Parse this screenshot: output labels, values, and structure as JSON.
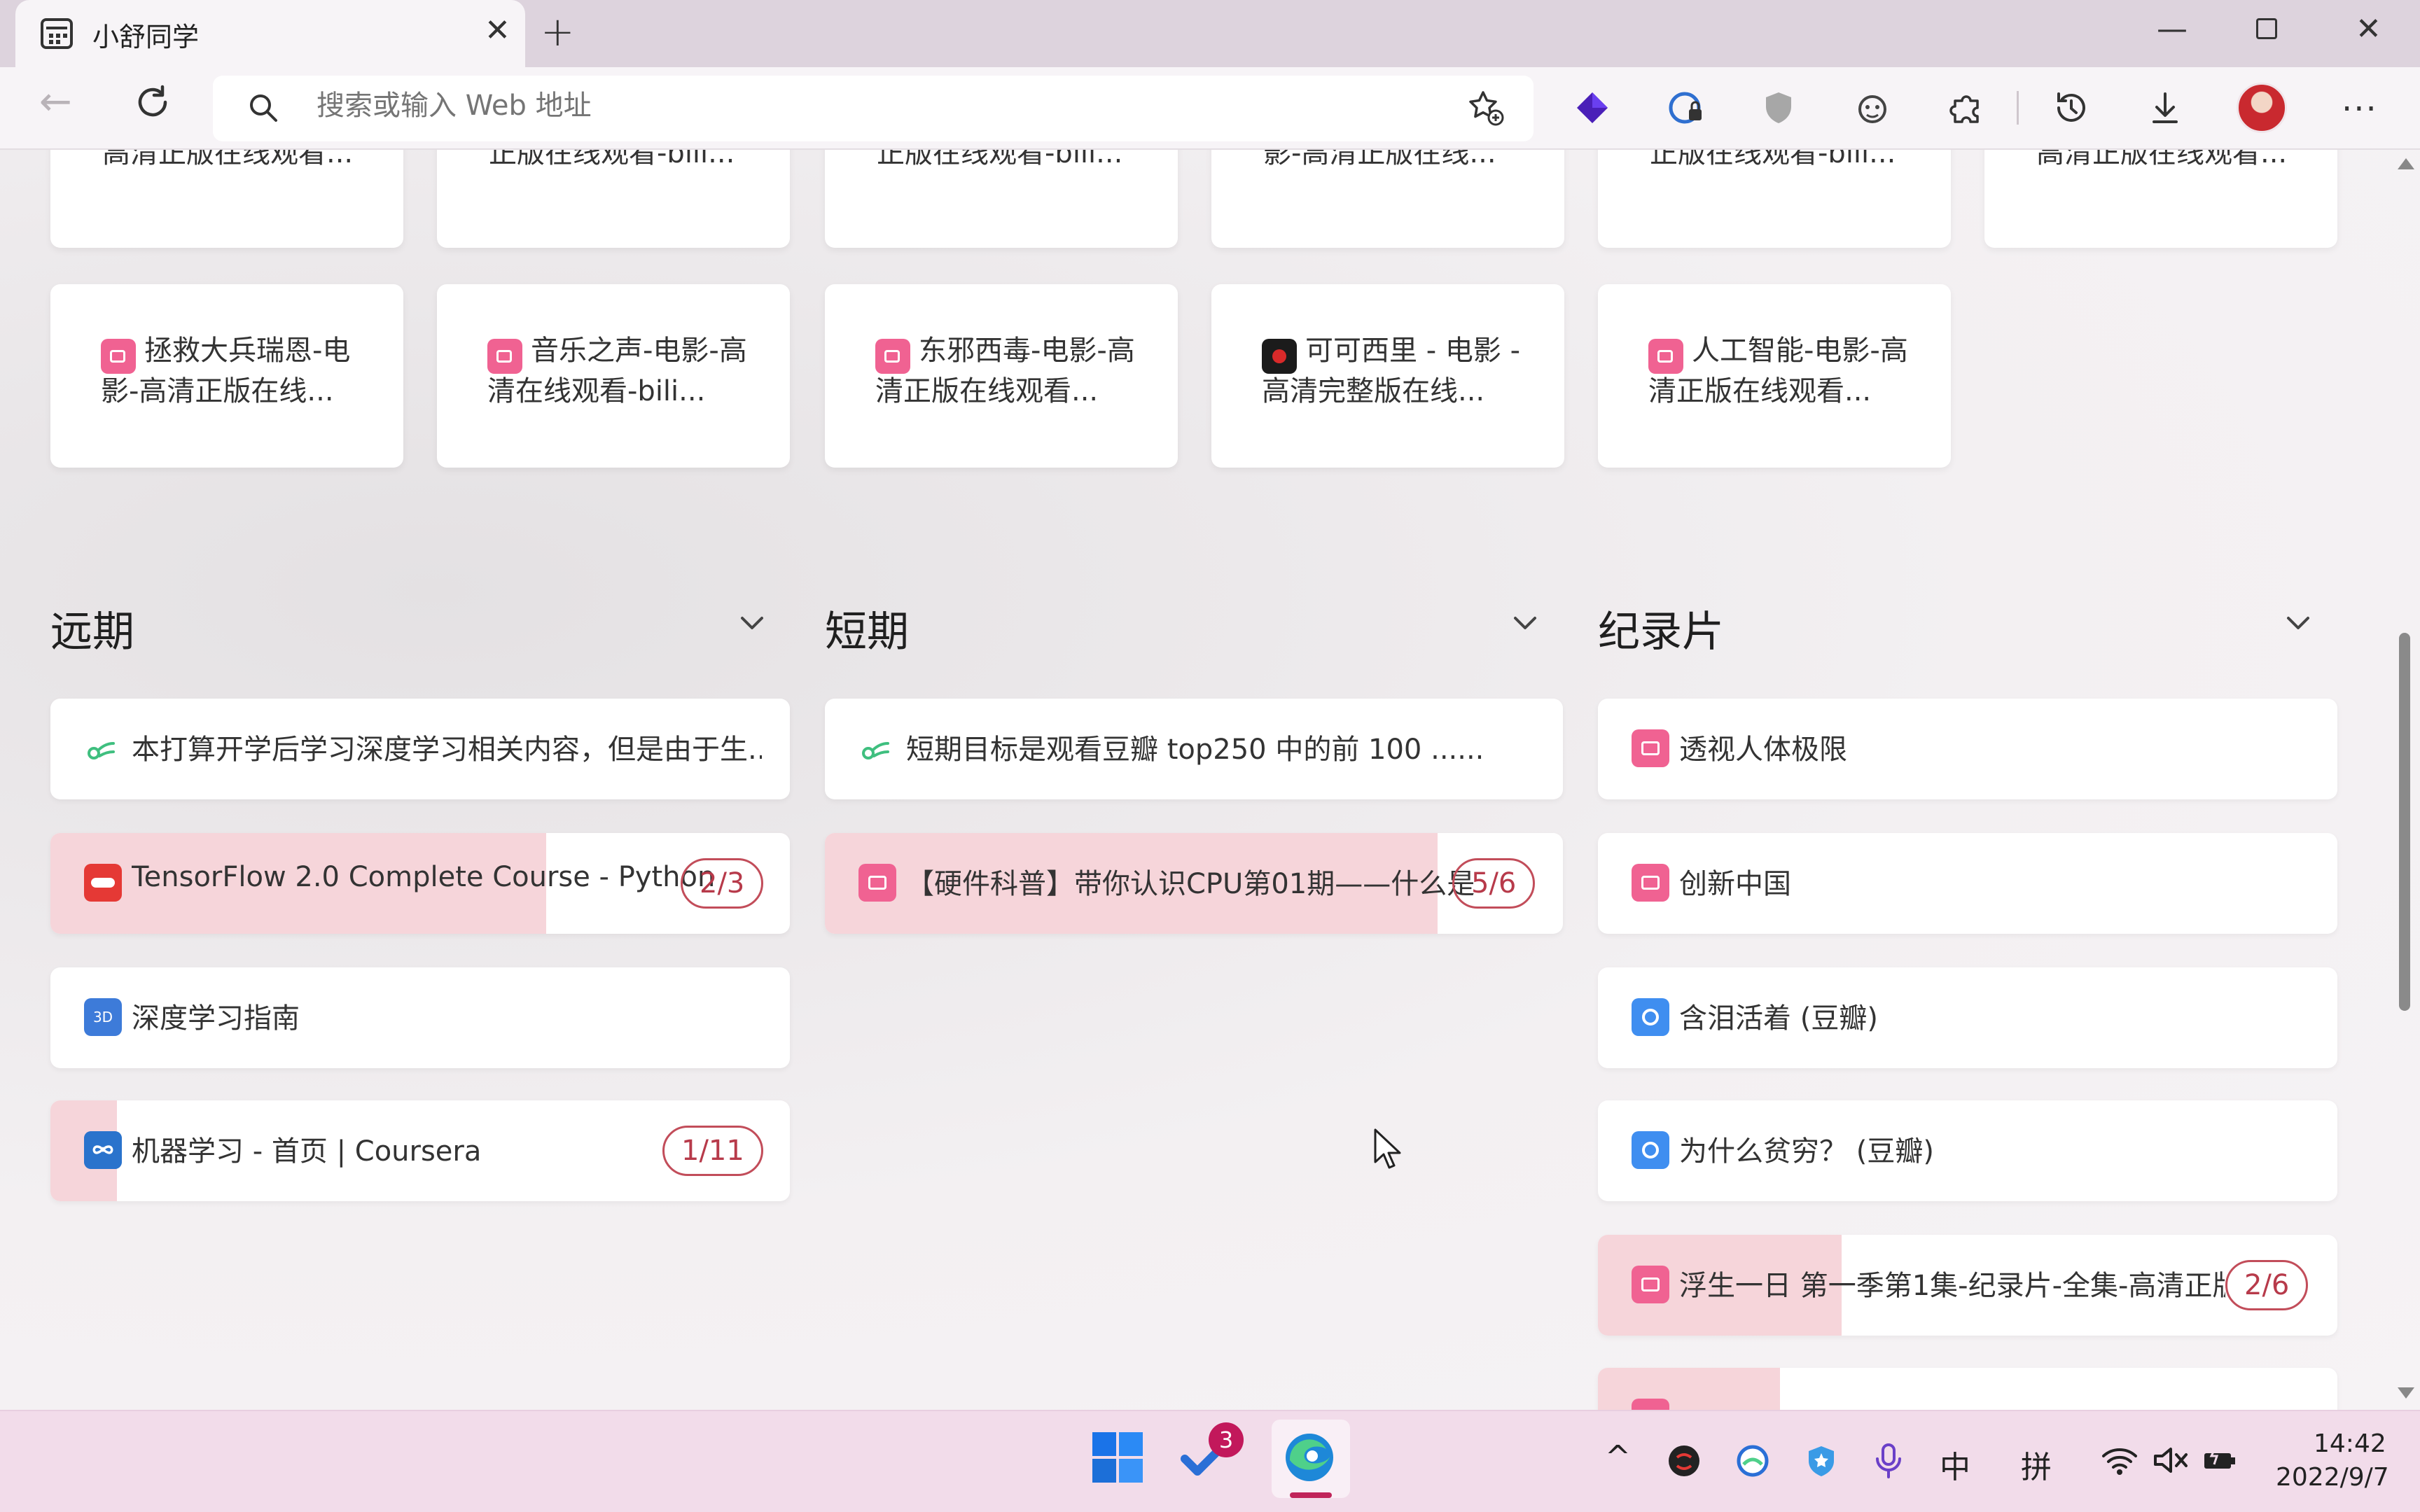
{
  "browser": {
    "tab_title": "小舒同学",
    "address_placeholder": "搜索或输入 Web 地址"
  },
  "top_row_cards": [
    {
      "label": "高清正版在线观看..."
    },
    {
      "label": "正版在线观看-bili..."
    },
    {
      "label": "正版在线观看-bili..."
    },
    {
      "label": "影-高清正版在线..."
    },
    {
      "label": "正版在线观看-bili..."
    },
    {
      "label": "高清正版在线观看..."
    }
  ],
  "movie_cards": [
    {
      "label": "拯救大兵瑞恩-电影-高清正版在线...",
      "icon": "bilibili-icon"
    },
    {
      "label": "音乐之声-电影-高清在线观看-bili...",
      "icon": "bilibili-icon"
    },
    {
      "label": "东邪西毒-电影-高清正版在线观看...",
      "icon": "bilibili-icon"
    },
    {
      "label": "可可西里 - 电影 - 高清完整版在线...",
      "icon": "youku-icon"
    },
    {
      "label": "人工智能-电影-高清正版在线观看...",
      "icon": "bilibili-icon"
    }
  ],
  "sections": {
    "long_term": {
      "title": "远期",
      "items": [
        {
          "label": "本打算开学后学习深度学习相关内容，但是由于生...",
          "icon": "note-icon",
          "badge": "",
          "progress": 0
        },
        {
          "label": "TensorFlow 2.0 Complete Course - Python",
          "icon": "youtube-icon",
          "badge": "2/3",
          "progress": 0.67
        },
        {
          "label": "深度学习指南",
          "icon": "book-icon",
          "badge": "",
          "progress": 0
        },
        {
          "label": "机器学习 - 首页 | Coursera",
          "icon": "coursera-icon",
          "badge": "1/11",
          "progress": 0.09
        }
      ]
    },
    "short_term": {
      "title": "短期",
      "items": [
        {
          "label": "短期目标是观看豆瓣 top250 中的前 100 ......",
          "icon": "note-icon",
          "badge": "",
          "progress": 0
        },
        {
          "label": "【硬件科普】带你认识CPU第01期——什么是",
          "icon": "bilibili-icon",
          "badge": "5/6",
          "progress": 0.83
        }
      ]
    },
    "documentary": {
      "title": "纪录片",
      "items": [
        {
          "label": "透视人体极限",
          "icon": "bilibili-icon",
          "badge": "",
          "progress": 0
        },
        {
          "label": "创新中国",
          "icon": "bilibili-icon",
          "badge": "",
          "progress": 0
        },
        {
          "label": "含泪活着 (豆瓣)",
          "icon": "douban-icon",
          "badge": "",
          "progress": 0
        },
        {
          "label": "为什么贫穷？ (豆瓣)",
          "icon": "douban-icon",
          "badge": "",
          "progress": 0
        },
        {
          "label": "浮生一日 第一季第1集-纪录片-全集-高清正版",
          "icon": "bilibili-icon",
          "badge": "2/6",
          "progress": 0.33
        }
      ]
    }
  },
  "taskbar": {
    "todo_badge": "3",
    "ime_lang": "中",
    "ime_mode": "拼",
    "time": "14:42",
    "date": "2022/9/7"
  },
  "colors": {
    "progress_fill": "#f6d5da",
    "badge_border": "#c24d5a",
    "bilibili_pink": "#f06292",
    "taskbar_bg": "#f2dcea"
  }
}
